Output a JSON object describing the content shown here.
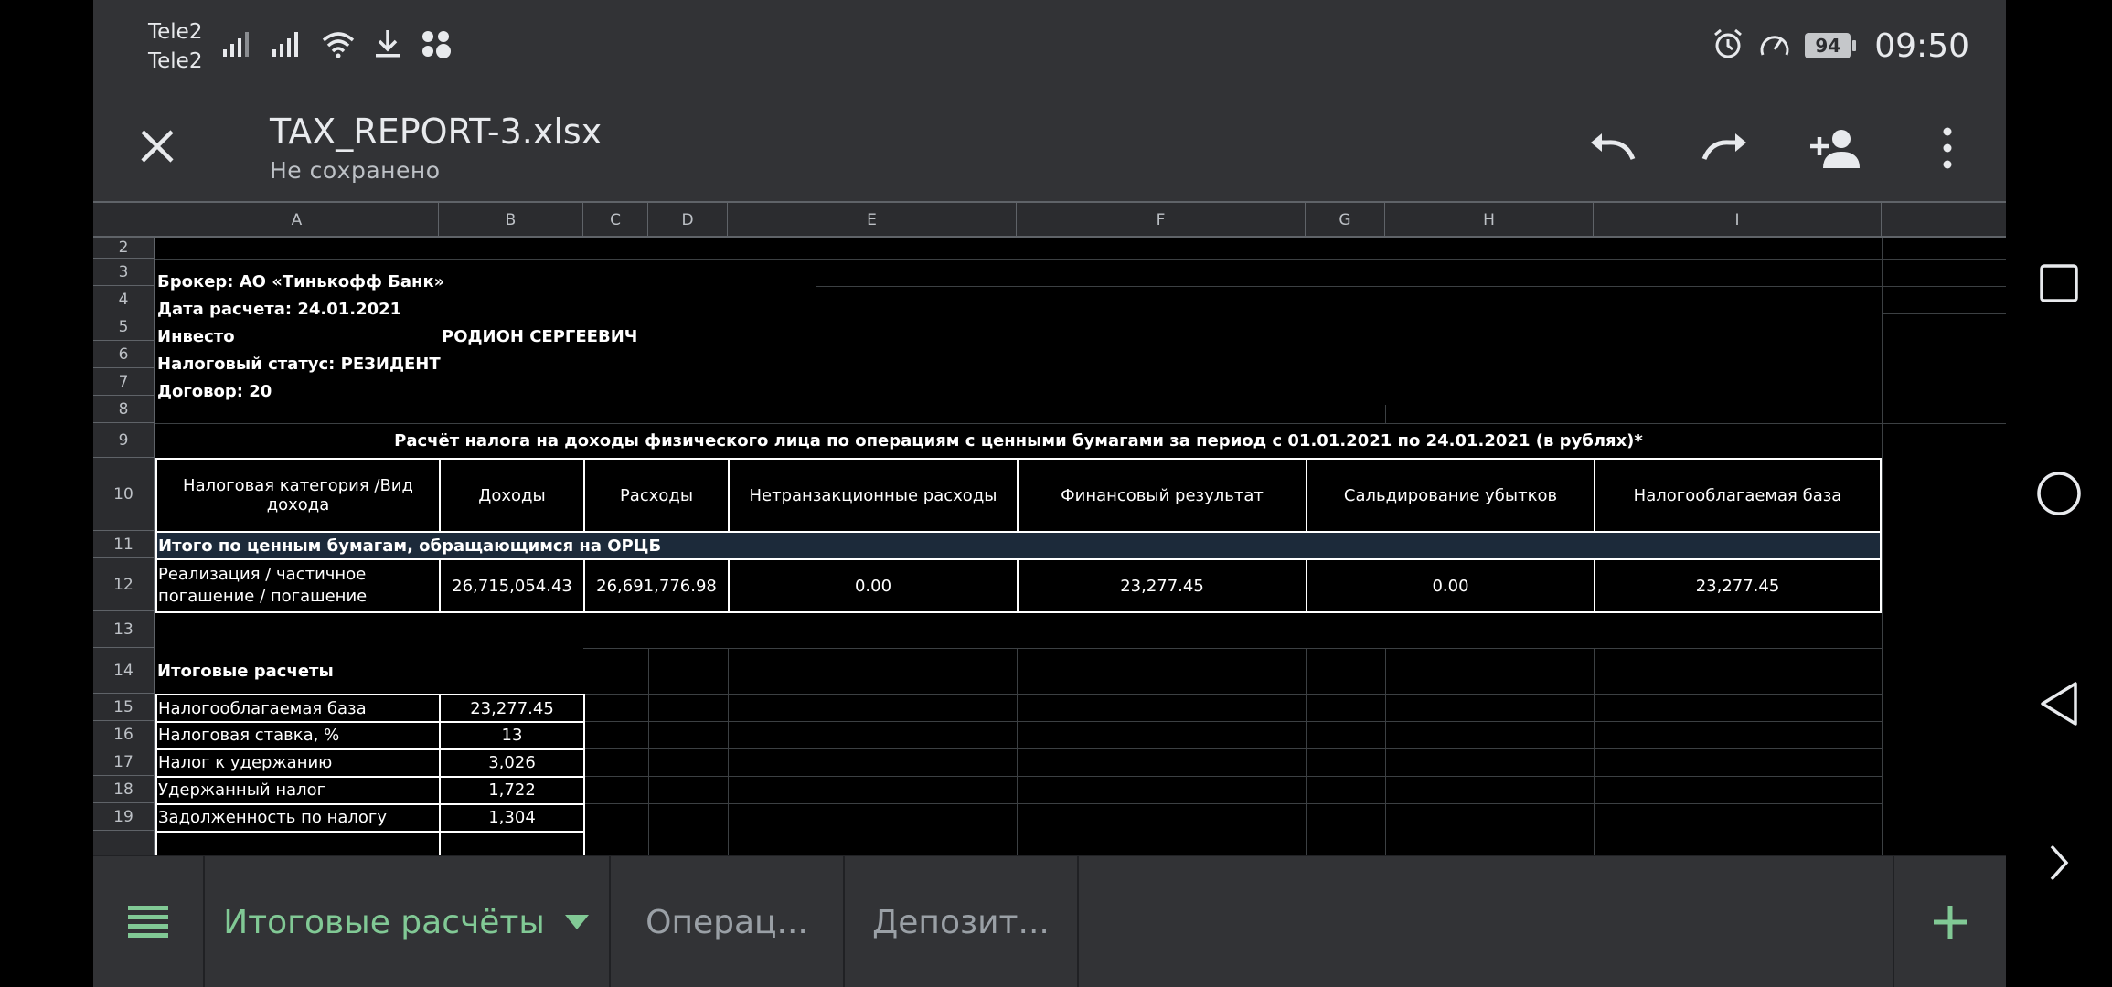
{
  "status_bar": {
    "carrier1": "Tele2",
    "carrier2": "Tele2",
    "battery": "94",
    "time": "09:50",
    "icons_left": [
      "signal-icon",
      "signal-icon",
      "wifi-icon",
      "download-icon",
      "app-notification-icon"
    ],
    "icons_right": [
      "alarm-icon",
      "speed-icon",
      "battery-icon"
    ]
  },
  "toolbar": {
    "title": "TAX_REPORT-3.xlsx",
    "subtitle": "Не сохранено",
    "icons": [
      "close-icon",
      "undo-icon",
      "redo-icon",
      "add-person-icon",
      "more-vert-icon"
    ]
  },
  "sheet": {
    "columns": [
      "A",
      "B",
      "C",
      "D",
      "E",
      "F",
      "G",
      "H",
      "I"
    ],
    "rows": [
      "2",
      "3",
      "4",
      "5",
      "6",
      "7",
      "8",
      "9",
      "10",
      "11",
      "12",
      "13",
      "14",
      "15",
      "16",
      "17",
      "18",
      "19"
    ],
    "info": {
      "broker": "Брокер: АО «Тинькофф Банк»",
      "date": "Дата расчета: 24.01.2021",
      "investor_prefix": "Инвесто",
      "investor_name": "РОДИОН СЕРГЕЕВИЧ",
      "tax_status": "Налоговый статус: РЕЗИДЕНТ",
      "contract": "Договор: 20"
    },
    "report_title": "Расчёт налога на доходы физического лица по операциям с ценными бумагами за период с 01.01.2021 по 24.01.2021 (в рублях)*",
    "table_headers": [
      "Налоговая категория /Вид дохода",
      "Доходы",
      "Расходы",
      "Нетранзакционные расходы",
      "Финансовый результат",
      "Сальдирование убытков",
      "Налогооблагаемая база"
    ],
    "section_row": "Итого по ценным бумагам, обращающимся на ОРЦБ",
    "data_row": {
      "category": "Реализация / частичное погашение / погашение",
      "income": "26,715,054.43",
      "expenses": "26,691,776.98",
      "nontrans": "0.00",
      "fin_result": "23,277.45",
      "loss_offset": "0.00",
      "tax_base": "23,277.45"
    },
    "summary_title": "Итоговые расчеты",
    "summary": [
      {
        "label": "Налогооблагаемая база",
        "value": "23,277.45"
      },
      {
        "label": "Налоговая ставка, %",
        "value": "13"
      },
      {
        "label": "Налог к удержанию",
        "value": "3,026"
      },
      {
        "label": "Удержанный налог",
        "value": "1,722"
      },
      {
        "label": "Задолженность по налогу",
        "value": "1,304"
      }
    ]
  },
  "tabs": {
    "items": [
      "Итоговые расчёты",
      "Операц...",
      "Депозит..."
    ],
    "icons": [
      "menu-icon",
      "dropdown-icon",
      "add-icon"
    ]
  },
  "nav": {
    "icons": [
      "recents-icon",
      "home-icon",
      "back-icon",
      "chevron-right-icon"
    ]
  },
  "colors": {
    "accent": "#81c995",
    "toolbar_bg": "#323336",
    "section_bg": "#1c2a3a"
  }
}
